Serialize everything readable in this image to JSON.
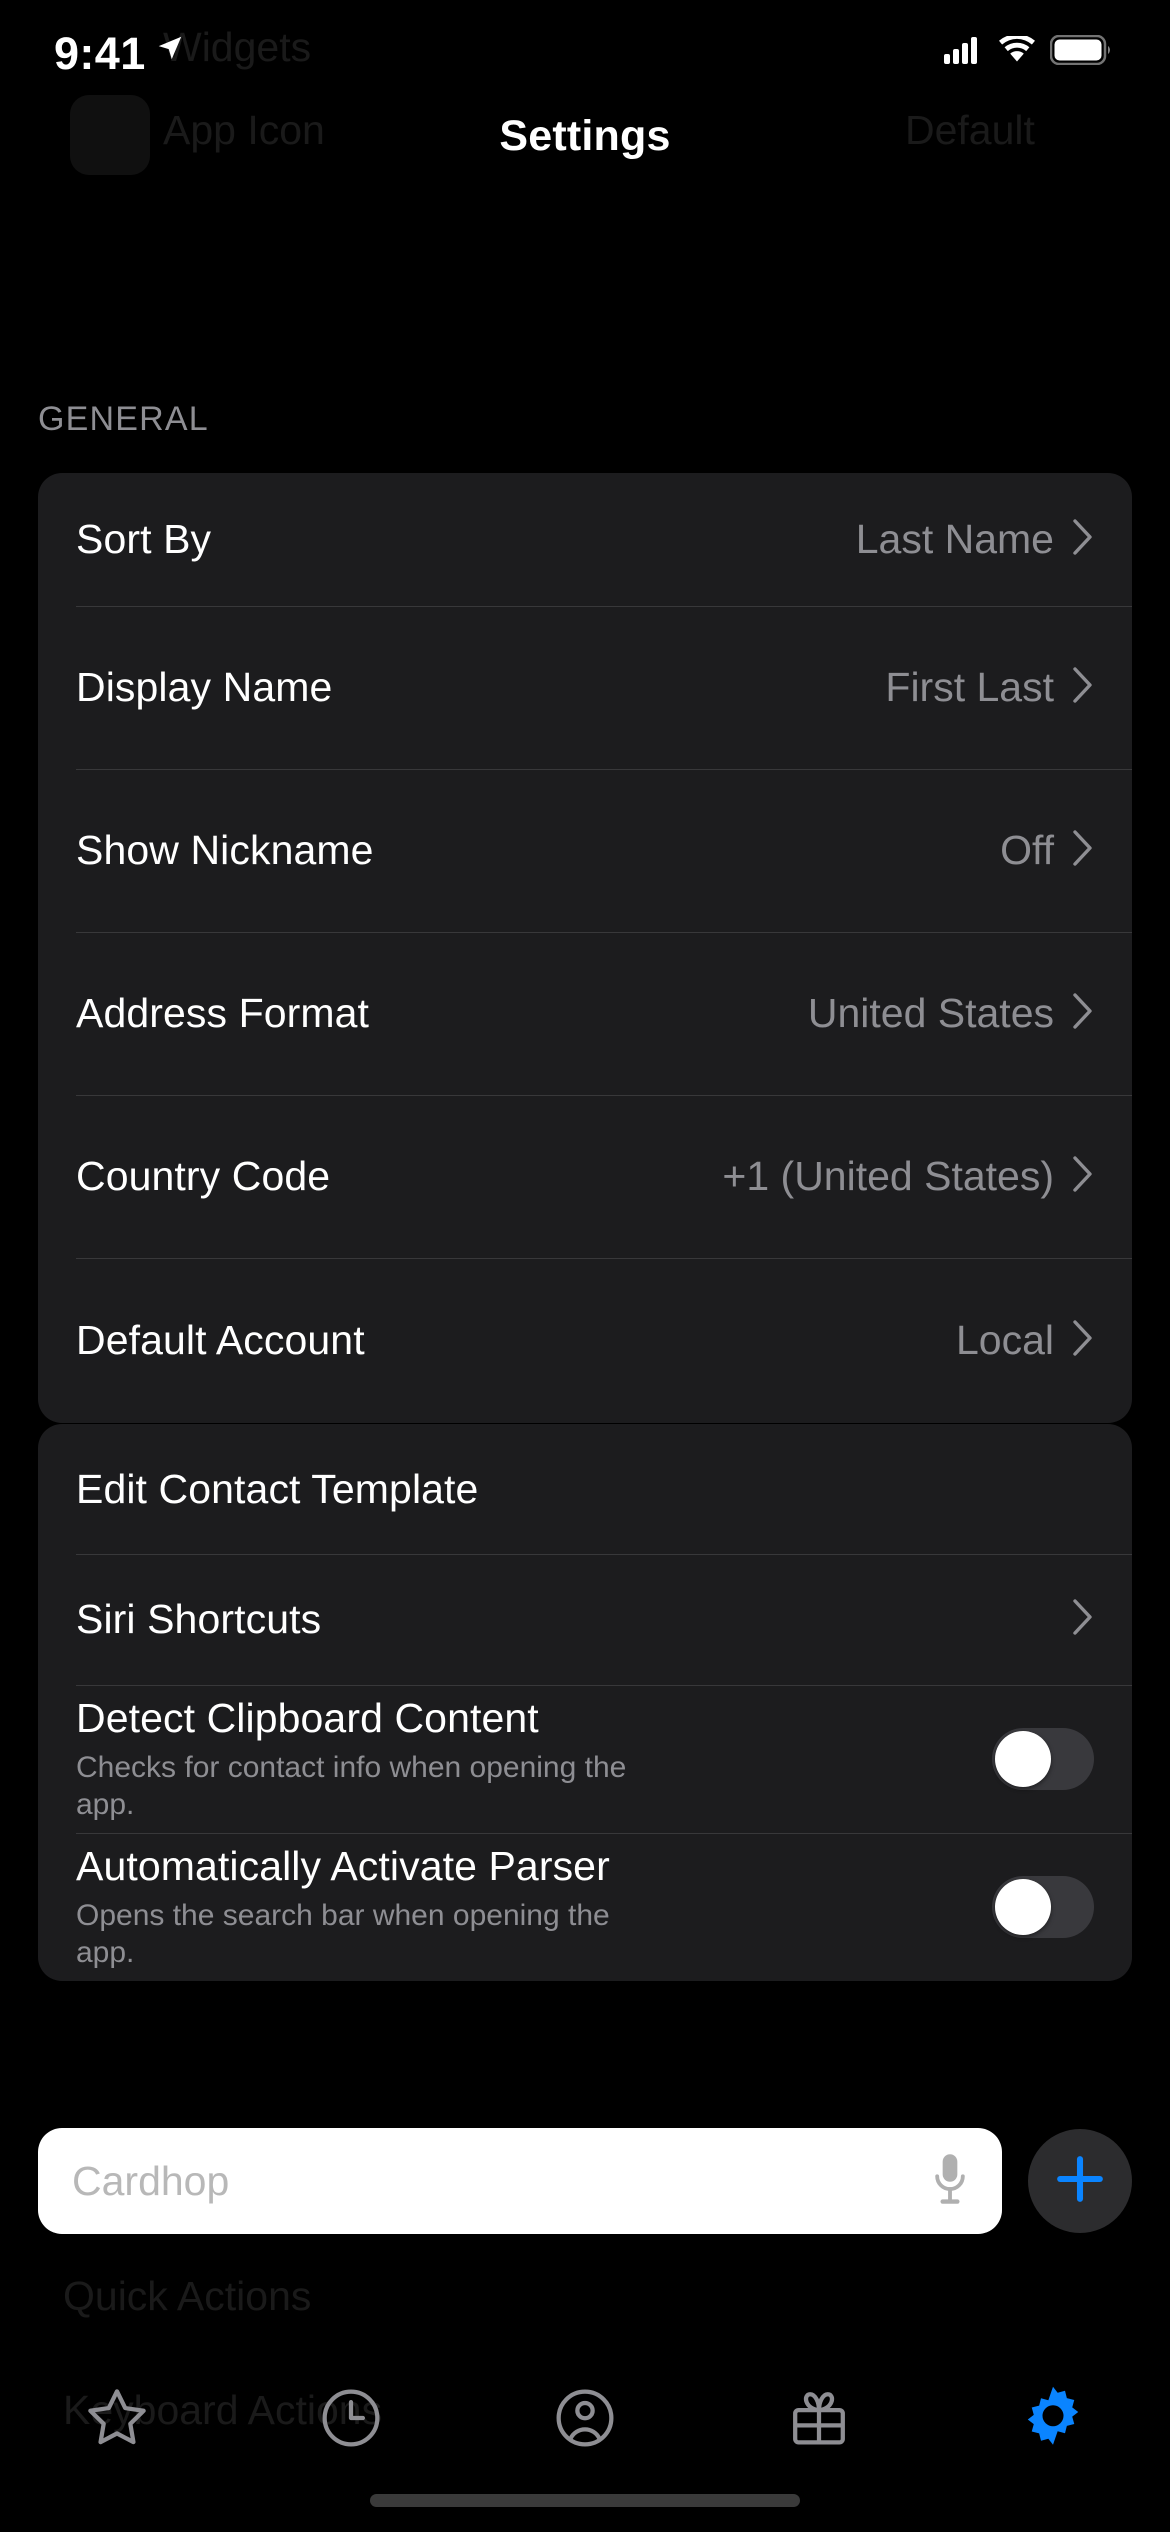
{
  "status_bar": {
    "time": "9:41",
    "location_icon": "location-arrow-icon",
    "cellular_icon": "cellular-bars-icon",
    "wifi_icon": "wifi-icon",
    "battery_icon": "battery-full-icon"
  },
  "nav": {
    "title": "Settings"
  },
  "background_ghost": {
    "widgets_label": "Widgets",
    "app_icon_label": "App Icon",
    "app_icon_value": "Default",
    "quick_actions_label": "Quick Actions",
    "keyboard_actions_label": "Keyboard Actions"
  },
  "sections": [
    {
      "header": "GENERAL",
      "rows": [
        {
          "title": "Sort By",
          "value": "Last Name",
          "accessory": "chevron"
        },
        {
          "title": "Display Name",
          "value": "First Last",
          "accessory": "chevron"
        },
        {
          "title": "Show Nickname",
          "value": "Off",
          "accessory": "chevron"
        },
        {
          "title": "Address Format",
          "value": "United States",
          "accessory": "chevron"
        },
        {
          "title": "Country Code",
          "value": "+1 (United States)",
          "accessory": "chevron"
        },
        {
          "title": "Default Account",
          "value": "Local",
          "accessory": "chevron"
        }
      ]
    },
    {
      "header": "",
      "rows": [
        {
          "title": "Edit Contact Template",
          "value": "",
          "accessory": "none"
        },
        {
          "title": "Siri Shortcuts",
          "value": "",
          "accessory": "chevron"
        },
        {
          "title": "Detect Clipboard Content",
          "subtitle": "Checks for contact info when opening the app.",
          "accessory": "toggle",
          "toggle_on": false
        },
        {
          "title": "Automatically Activate Parser",
          "subtitle": "Opens the search bar when opening the app.",
          "accessory": "toggle",
          "toggle_on": false
        }
      ]
    }
  ],
  "search": {
    "placeholder": "Cardhop",
    "mic_icon": "microphone-icon",
    "add_icon": "plus-icon"
  },
  "tabbar": {
    "items": [
      {
        "icon": "star-icon",
        "active": false
      },
      {
        "icon": "clock-icon",
        "active": false
      },
      {
        "icon": "person-circle-icon",
        "active": false
      },
      {
        "icon": "gift-icon",
        "active": false
      },
      {
        "icon": "gear-icon",
        "active": true
      }
    ]
  },
  "colors": {
    "accent": "#0a84ff",
    "background": "#000000",
    "card": "#1c1c1e",
    "separator": "#38383a",
    "secondary_text": "#8e8e93",
    "toggle_off_track": "#39393d",
    "search_field": "#ffffff"
  }
}
